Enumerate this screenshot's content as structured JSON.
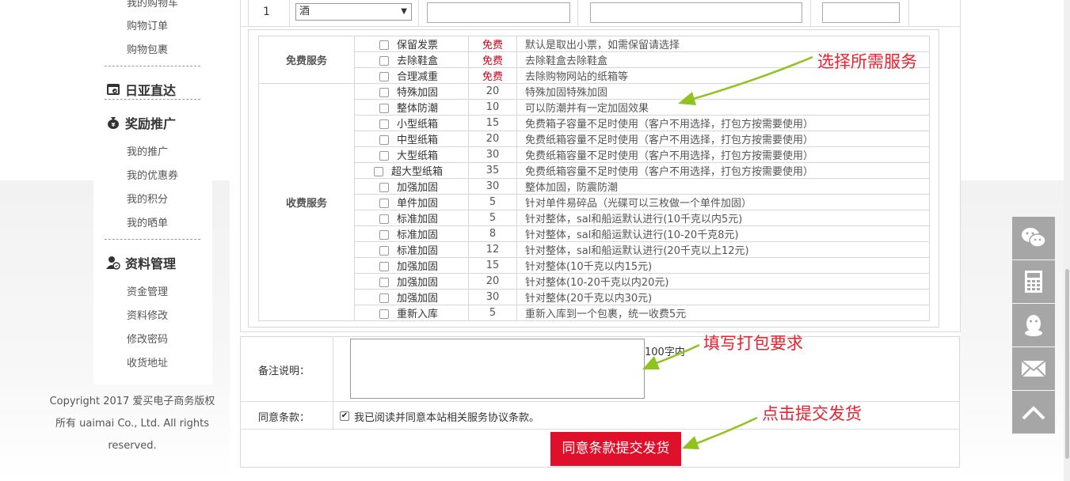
{
  "sidebar": {
    "link_top_partial": "我的购物车",
    "link_orders": "购物订单",
    "link_parcels": "购物包裹",
    "section_japan": "日亚直达",
    "section_rewards": "奖励推广",
    "link_promotion": "我的推广",
    "link_coupons": "我的优惠券",
    "link_points": "我的积分",
    "link_show": "我的晒单",
    "section_profile": "资料管理",
    "link_funds": "资金管理",
    "link_edit": "资料修改",
    "link_password": "修改密码",
    "link_address": "收货地址"
  },
  "copyright": {
    "line1": "Copyright 2017 爱买电子商务版权",
    "line2": "所有 uaimai Co., Ltd. All rights",
    "line3": "reserved."
  },
  "item_row": {
    "index": "1",
    "select_value": "酒"
  },
  "services": {
    "free_label": "免费服务",
    "paid_label": "收费服务",
    "free": [
      {
        "name": "保留发票",
        "price": "免费",
        "desc": "默认是取出小票，如需保留请选择"
      },
      {
        "name": "去除鞋盒",
        "price": "免费",
        "desc": "去除鞋盒去除鞋盒"
      },
      {
        "name": "合理减重",
        "price": "免费",
        "desc": "去除购物网站的纸箱等"
      }
    ],
    "paid": [
      {
        "name": "特殊加固",
        "price": "20",
        "desc": "特殊加固特殊加固"
      },
      {
        "name": "整体防潮",
        "price": "10",
        "desc": "可以防潮并有一定加固效果"
      },
      {
        "name": "小型纸箱",
        "price": "15",
        "desc": "免费箱子容量不足时使用（客户不用选择，打包方按需要使用）"
      },
      {
        "name": "中型纸箱",
        "price": "20",
        "desc": "免费纸箱容量不足时使用（客户不用选择，打包方按需要使用）"
      },
      {
        "name": "大型纸箱",
        "price": "30",
        "desc": "免费纸箱容量不足时使用（客户不用选择，打包方按需要使用）"
      },
      {
        "name": "超大型纸箱",
        "price": "35",
        "desc": "免费纸箱容量不足时使用（客户不用选择，打包方按需要使用）"
      },
      {
        "name": "加强加固",
        "price": "30",
        "desc": "整体加固，防震防潮"
      },
      {
        "name": "单件加固",
        "price": "5",
        "desc": "针对单件易碎品（光碟可以三枚做一个单件加固）"
      },
      {
        "name": "标准加固",
        "price": "5",
        "desc": "针对整体，sal和船运默认进行(10千克以内5元)"
      },
      {
        "name": "标准加固",
        "price": "8",
        "desc": "针对整体，sal和船运默认进行(10-20千克8元)"
      },
      {
        "name": "标准加固",
        "price": "12",
        "desc": "针对整体，sal和船运默认进行(20千克以上12元)"
      },
      {
        "name": "加强加固",
        "price": "15",
        "desc": "针对整体(10千克以内15元)"
      },
      {
        "name": "加强加固",
        "price": "20",
        "desc": "针对整体(10-20千克以内20元)"
      },
      {
        "name": "加强加固",
        "price": "30",
        "desc": "针对整体(20千克以内30元)"
      },
      {
        "name": "重新入库",
        "price": "5",
        "desc": "重新入库到一个包裹，统一收费5元"
      }
    ]
  },
  "form": {
    "remark_label": "备注说明：",
    "remark_hint": "100字内",
    "terms_label": "同意条款：",
    "terms_text": "我已阅读并同意本站相关服务协议条款。",
    "terms_checked": true,
    "submit_label": "同意条款提交发货"
  },
  "annotations": {
    "select_services": "选择所需服务",
    "fill_requirements": "填写打包要求",
    "click_submit": "点击提交发货"
  },
  "colors": {
    "accent_red": "#e0102a",
    "annotation_red": "#e8222e",
    "arrow_green": "#8fc31f",
    "side_button_gray": "#a6a6a6"
  },
  "side_buttons": [
    "wechat-icon",
    "calculator-icon",
    "qq-icon",
    "mail-icon",
    "back-to-top-icon"
  ]
}
